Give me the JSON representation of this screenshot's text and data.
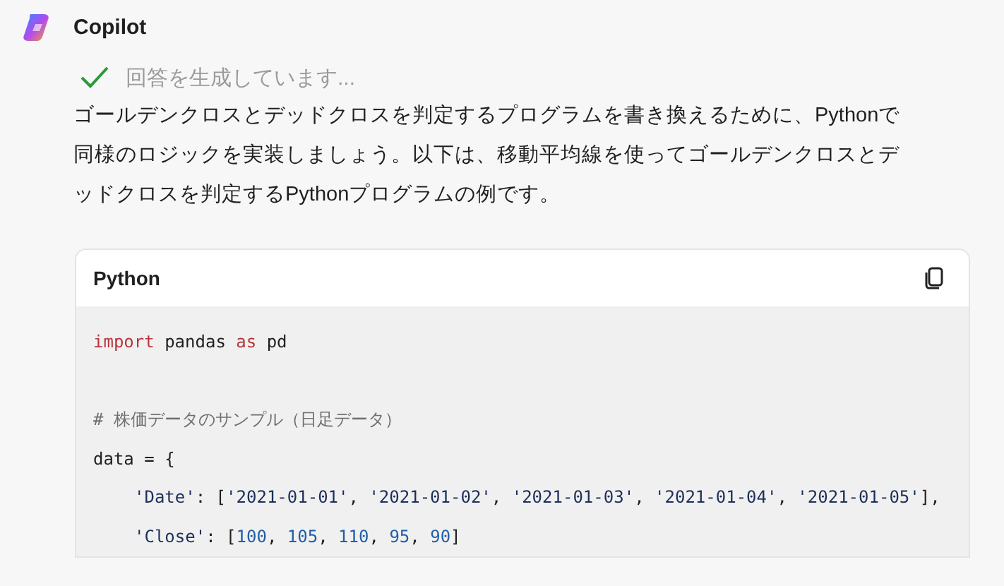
{
  "assistant": {
    "name": "Copilot"
  },
  "status": {
    "text": "回答を生成しています...",
    "done": true
  },
  "message": "ゴールデンクロスとデッドクロスを判定するプログラムを書き換えるために、Pythonで同様のロジックを実装しましょう。以下は、移動平均線を使ってゴールデンクロスとデッドクロスを判定するPythonプログラムの例です。",
  "code_block": {
    "language": "Python",
    "lines": [
      {
        "kind": "code",
        "indented": false,
        "tokens": [
          {
            "kind": "keyword",
            "text": "import"
          },
          {
            "kind": "plain",
            "text": " pandas "
          },
          {
            "kind": "keyword",
            "text": "as"
          },
          {
            "kind": "plain",
            "text": " pd"
          }
        ]
      },
      {
        "kind": "blank"
      },
      {
        "kind": "code",
        "indented": false,
        "tokens": [
          {
            "kind": "comment",
            "text": "# 株価データのサンプル（日足データ）"
          }
        ]
      },
      {
        "kind": "code",
        "indented": false,
        "tokens": [
          {
            "kind": "plain",
            "text": "data = {"
          }
        ]
      },
      {
        "kind": "code",
        "indented": true,
        "tokens": [
          {
            "kind": "string",
            "text": "'Date'"
          },
          {
            "kind": "plain",
            "text": ": ["
          },
          {
            "kind": "string",
            "text": "'2021-01-01'"
          },
          {
            "kind": "plain",
            "text": ", "
          },
          {
            "kind": "string",
            "text": "'2021-01-02'"
          },
          {
            "kind": "plain",
            "text": ", "
          },
          {
            "kind": "string",
            "text": "'2021-01-03'"
          },
          {
            "kind": "plain",
            "text": ", "
          },
          {
            "kind": "string",
            "text": "'2021-01-04'"
          },
          {
            "kind": "plain",
            "text": ", "
          },
          {
            "kind": "string",
            "text": "'2021-01-05'"
          },
          {
            "kind": "plain",
            "text": "],"
          }
        ]
      },
      {
        "kind": "code",
        "indented": true,
        "tokens": [
          {
            "kind": "string",
            "text": "'Close'"
          },
          {
            "kind": "plain",
            "text": ": ["
          },
          {
            "kind": "number",
            "text": "100"
          },
          {
            "kind": "plain",
            "text": ", "
          },
          {
            "kind": "number",
            "text": "105"
          },
          {
            "kind": "plain",
            "text": ", "
          },
          {
            "kind": "number",
            "text": "110"
          },
          {
            "kind": "plain",
            "text": ", "
          },
          {
            "kind": "number",
            "text": "95"
          },
          {
            "kind": "plain",
            "text": ", "
          },
          {
            "kind": "number",
            "text": "90"
          },
          {
            "kind": "plain",
            "text": "]"
          }
        ]
      }
    ]
  }
}
